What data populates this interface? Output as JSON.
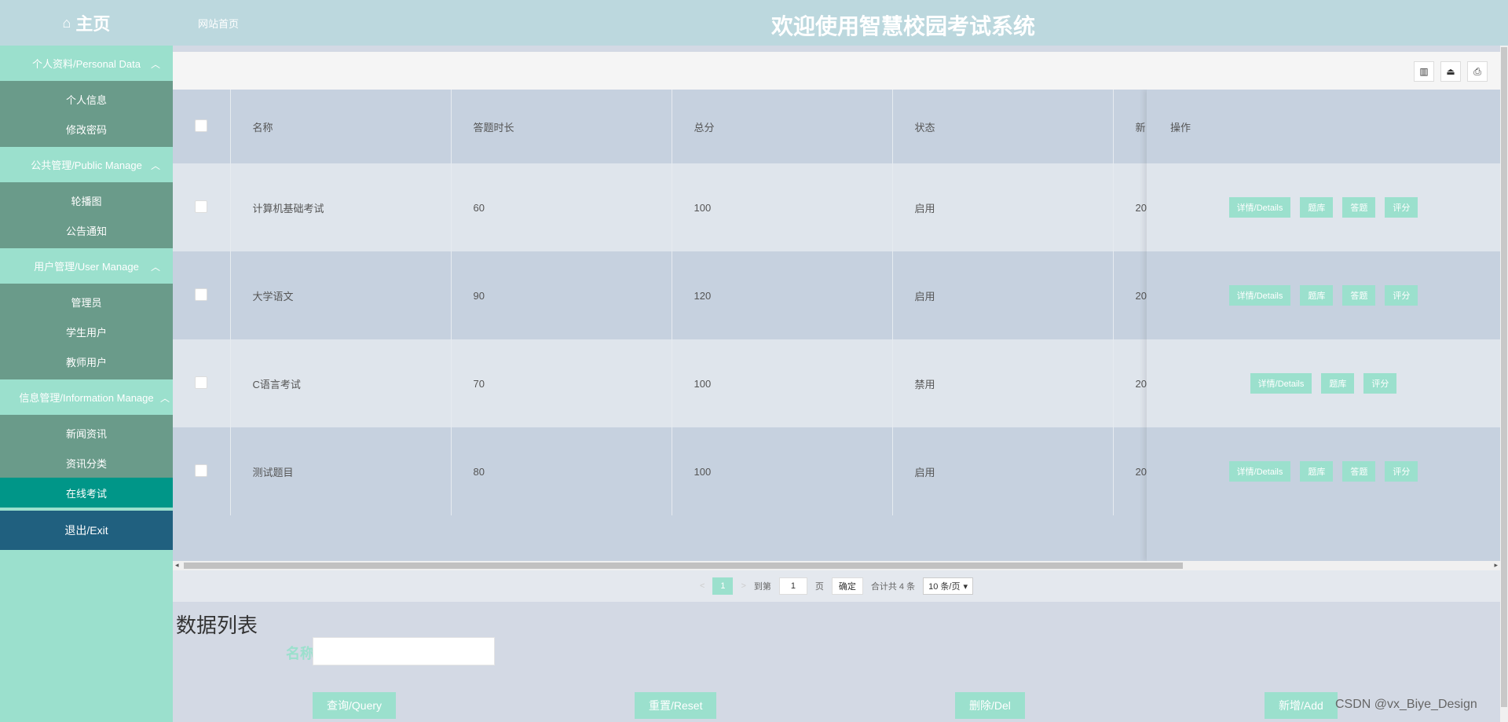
{
  "header": {
    "home_label": "主页",
    "site_link": "网站首页",
    "title": "欢迎使用智慧校园考试系统"
  },
  "sidebar": {
    "groups": [
      {
        "title": "个人资料/Personal Data",
        "items": [
          "个人信息",
          "修改密码"
        ]
      },
      {
        "title": "公共管理/Public Manage",
        "items": [
          "轮播图",
          "公告通知"
        ]
      },
      {
        "title": "用户管理/User Manage",
        "items": [
          "管理员",
          "学生用户",
          "教师用户"
        ]
      },
      {
        "title": "信息管理/Information Manage",
        "items": [
          "新闻资讯",
          "资讯分类",
          "在线考试"
        ]
      }
    ],
    "active_item": "在线考试",
    "exit_label": "退出/Exit"
  },
  "toolbar": {
    "icons": [
      "columns-icon",
      "export-icon",
      "print-icon"
    ]
  },
  "table": {
    "headers": [
      "名称",
      "答题时长",
      "总分",
      "状态",
      "新",
      "操作"
    ],
    "rows": [
      {
        "name": "计算机基础考试",
        "duration": "60",
        "total": "100",
        "status": "启用",
        "extra": "20",
        "ops": [
          "详情/Details",
          "题库",
          "答题",
          "评分"
        ]
      },
      {
        "name": "大学语文",
        "duration": "90",
        "total": "120",
        "status": "启用",
        "extra": "20",
        "ops": [
          "详情/Details",
          "题库",
          "答题",
          "评分"
        ]
      },
      {
        "name": "C语言考试",
        "duration": "70",
        "total": "100",
        "status": "禁用",
        "extra": "20",
        "ops": [
          "详情/Details",
          "题库",
          "评分"
        ]
      },
      {
        "name": "测试题目",
        "duration": "80",
        "total": "100",
        "status": "启用",
        "extra": "20",
        "ops": [
          "详情/Details",
          "题库",
          "答题",
          "评分"
        ]
      }
    ]
  },
  "pager": {
    "current_page": "1",
    "goto_label": "到第",
    "goto_value": "1",
    "page_suffix": "页",
    "confirm_label": "确定",
    "total_label": "合计共 4 条",
    "page_size": "10 条/页"
  },
  "list": {
    "title": "数据列表",
    "search_label": "名称",
    "search_value": "",
    "buttons": {
      "query": "查询/Query",
      "reset": "重置/Reset",
      "delete": "删除/Del",
      "add": "新增/Add"
    }
  },
  "watermark": "CSDN @vx_Biye_Design",
  "colors": {
    "accent": "#9be0cd",
    "active": "#009688",
    "exit": "#20607f",
    "header": "#bcd8de"
  }
}
